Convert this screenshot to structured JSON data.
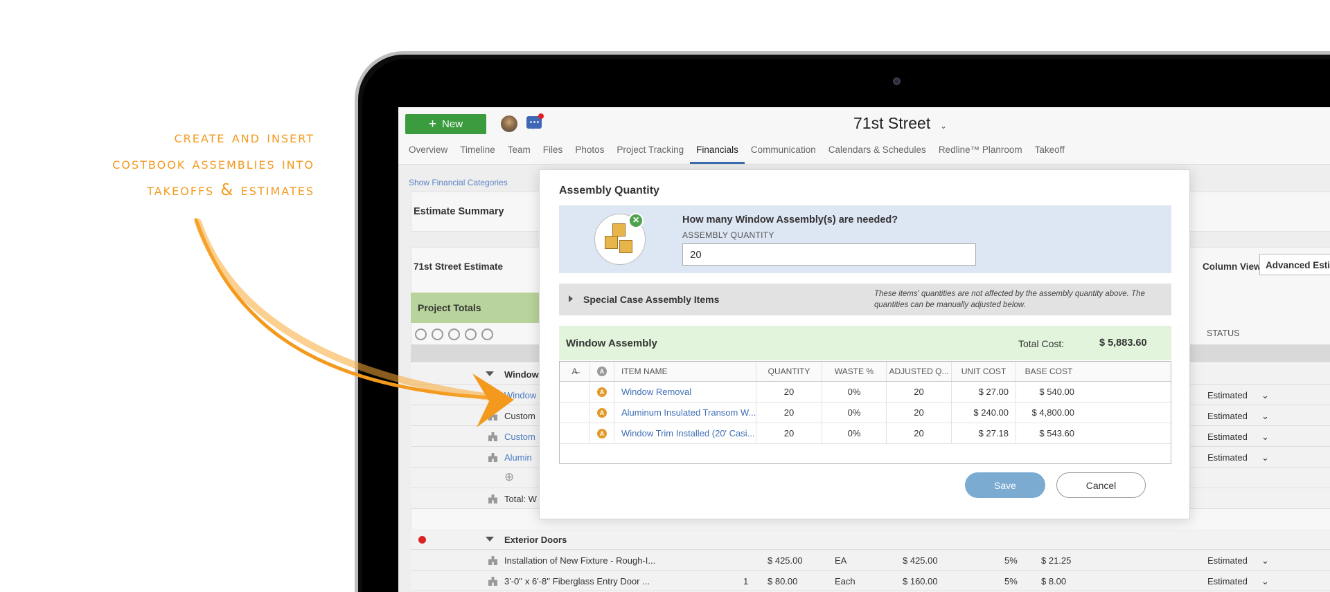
{
  "promo": {
    "lines": [
      "Create and insert",
      "costbook assemblies into",
      "takeoffs & estimates"
    ]
  },
  "colors": {
    "accent": "#f39a1e",
    "new_button": "#3a9c3f",
    "link": "#3f6fb5",
    "save_button": "#7cabd2"
  },
  "topbar": {
    "new_label": "New",
    "project_title": "71st Street",
    "caret": "⌄"
  },
  "nav": {
    "tabs": [
      "Overview",
      "Timeline",
      "Team",
      "Files",
      "Photos",
      "Project Tracking",
      "Financials",
      "Communication",
      "Calendars & Schedules",
      "Redline™ Planroom",
      "Takeoff"
    ],
    "active": "Financials"
  },
  "financials": {
    "show_categories": "Show Financial Categories",
    "estimate_summary": "Estimate Summary",
    "estimate_name": "71st Street Estimate",
    "column_view_label": "Column View:",
    "column_view_value": "Advanced Estimate",
    "project_totals": "Project Totals",
    "status_header": "STATUS"
  },
  "background_rows": [
    {
      "name": "Window",
      "kind": "group"
    },
    {
      "name": "Window",
      "kind": "link",
      "status": "Estimated"
    },
    {
      "name": "Custom",
      "kind": "text",
      "status": "Estimated"
    },
    {
      "name": "Custom",
      "kind": "link",
      "status": "Estimated"
    },
    {
      "name": "Alumin",
      "kind": "link",
      "status": "Estimated"
    },
    {
      "name": "",
      "kind": "add"
    },
    {
      "name": "Total: W",
      "kind": "text"
    },
    {
      "name": "Exterior Doors",
      "kind": "group"
    },
    {
      "name": "Installation of New Fixture - Rough-I...",
      "kind": "text",
      "qty": "",
      "cost": "$ 425.00",
      "unit": "EA",
      "total": "$ 425.00",
      "pct": "5%",
      "extra": "$ 21.25",
      "status": "Estimated"
    },
    {
      "name": "3'-0'' x 6'-8'' Fiberglass Entry Door ...",
      "kind": "text",
      "qty": "1",
      "cost": "$ 80.00",
      "unit": "Each",
      "total": "$ 160.00",
      "pct": "5%",
      "extra": "$ 8.00",
      "status": "Estimated"
    }
  ],
  "modal": {
    "title": "Assembly Quantity",
    "question": "How many Window Assembly(s) are needed?",
    "quantity_label": "ASSEMBLY QUANTITY",
    "quantity_value": "20",
    "special_label": "Special Case Assembly Items",
    "special_note": "These items' quantities are not affected by the assembly quantity above. The quantities can be manually adjusted below.",
    "assembly_name": "Window Assembly",
    "total_cost_label": "Total Cost:",
    "total_cost_value": "$ 5,883.60",
    "columns": [
      "ITEM NAME",
      "QUANTITY",
      "WASTE %",
      "ADJUSTED Q...",
      "UNIT COST",
      "BASE COST"
    ],
    "rows": [
      {
        "name": "Window Removal",
        "quantity": "20",
        "waste": "0%",
        "adjusted": "20",
        "unit_cost": "$ 27.00",
        "base_cost": "$ 540.00"
      },
      {
        "name": "Aluminum Insulated Transom W...",
        "quantity": "20",
        "waste": "0%",
        "adjusted": "20",
        "unit_cost": "$ 240.00",
        "base_cost": "$ 4,800.00"
      },
      {
        "name": "Window Trim Installed (20' Casi...",
        "quantity": "20",
        "waste": "0%",
        "adjusted": "20",
        "unit_cost": "$ 27.18",
        "base_cost": "$ 543.60"
      }
    ],
    "save_label": "Save",
    "cancel_label": "Cancel"
  }
}
